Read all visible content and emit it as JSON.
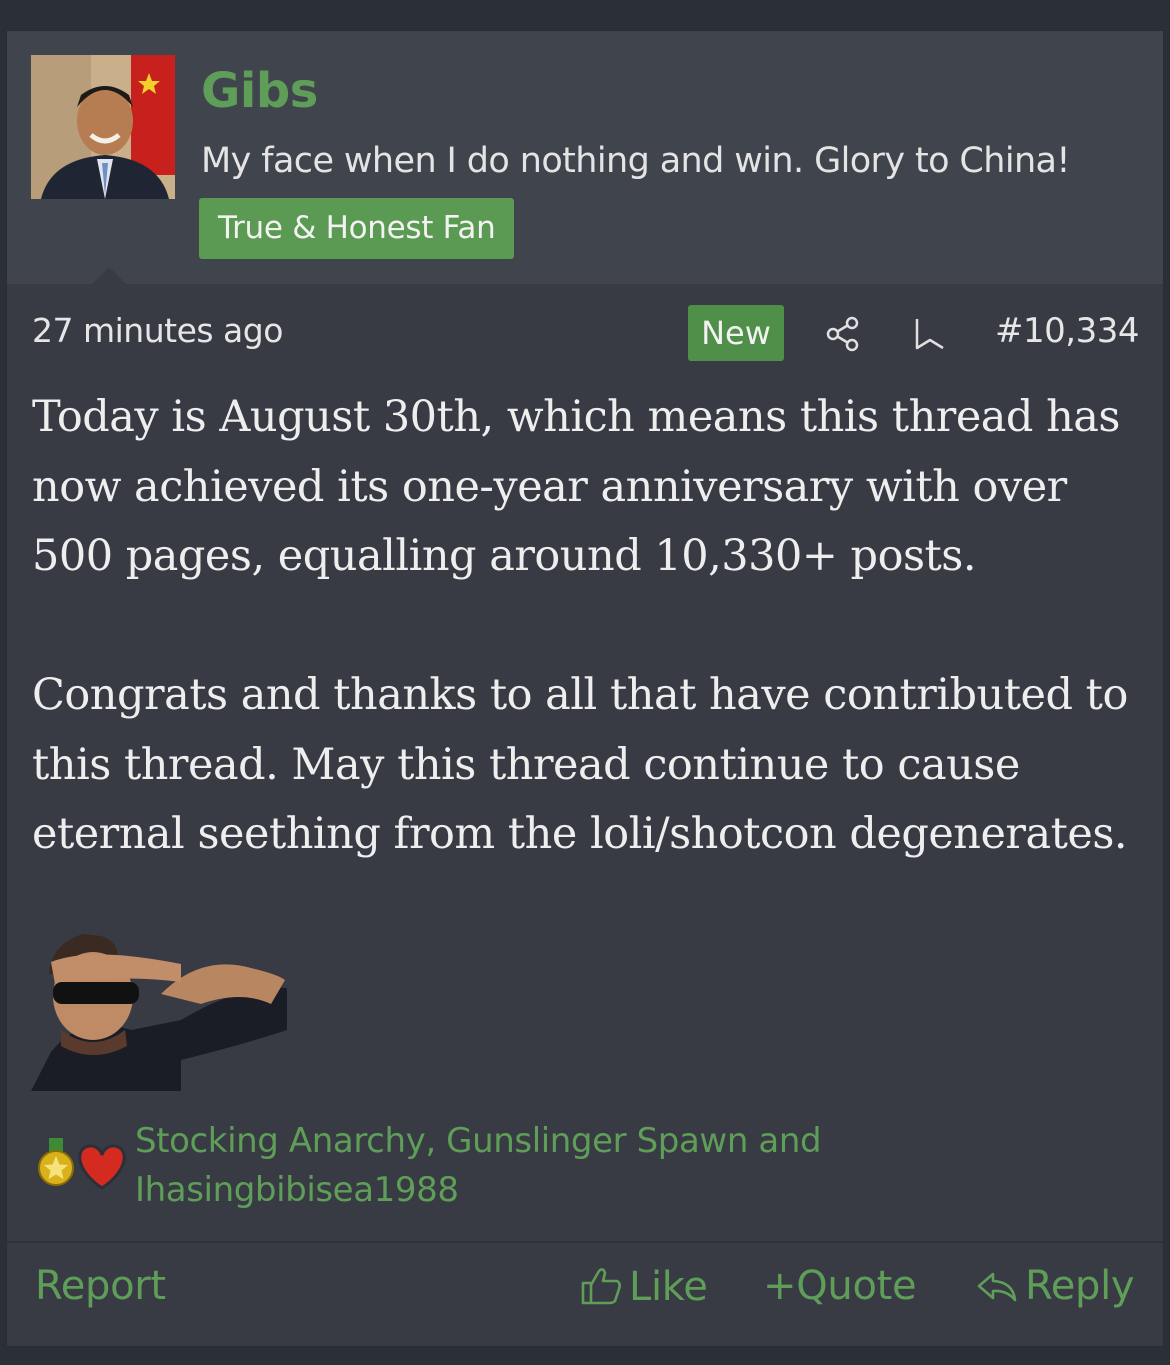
{
  "user": {
    "name": "Gibs",
    "title": "My face when I do nothing and win. Glory to China!",
    "banner": "True & Honest Fan"
  },
  "meta": {
    "time": "27 minutes ago",
    "new_badge": "New",
    "post_number": "#10,334"
  },
  "message": {
    "p1": "Today is August 30th, which means this thread has now achieved its one-year anniversary with over 500 pages, equalling around 10,330+ posts.",
    "p2": "Congrats and thanks to all that have contributed to this thread. May this thread continue to cause eternal seething from the loli/shotcon degenerates."
  },
  "reactions": {
    "icons": [
      "medal-icon",
      "heart-icon"
    ],
    "line1": "Stocking Anarchy, Gunslinger Spawn and",
    "line2": "Ihasingbibisea1988"
  },
  "actions": {
    "report": "Report",
    "like": "Like",
    "quote": "+Quote",
    "reply": "Reply"
  },
  "colors": {
    "page_bg": "#2b2f37",
    "post_bg": "#383b43",
    "userbar_bg": "#40444c",
    "accent": "#5f9e58",
    "banner_bg": "#5a9a52"
  }
}
